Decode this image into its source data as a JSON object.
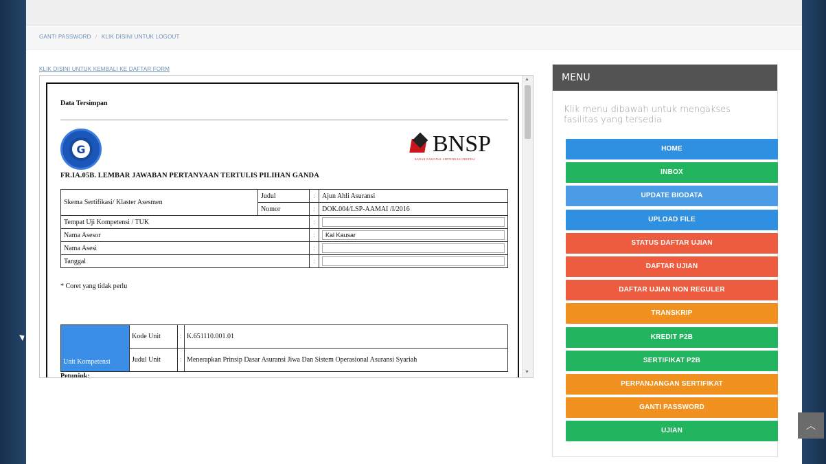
{
  "breadcrumb": {
    "change_password": "GANTI PASSWORD",
    "separator": "/",
    "logout": "KLIK DISINI UNTUK LOGOUT"
  },
  "back_link": "KLIK DISINI UNTUK KEMBALI KE DAFTAR FORM",
  "document": {
    "heading": "Data Tersimpan",
    "bnsp_logo_text": "BNSP",
    "bnsp_subtitle": "BADAN NASIONAL SERTIFIKASI PROFESI",
    "form_title": "FR.IA.05B. LEMBAR JAWABAN PERTANYAAN TERTULIS PILIHAN GANDA",
    "info": {
      "skema_label": "Skema Sertifikasi/ Klaster Asesmen",
      "judul_label": "Judul",
      "judul_value": "Ajun Ahli Asuransi",
      "nomor_label": "Nomor",
      "nomor_value": "DOK.004/LSP-AAMAI /I/2016",
      "tuk_label": "Tempat Uji Kompetensi / TUK",
      "tuk_value": "",
      "asesor_label": "Nama Asesor",
      "asesor_value": "Kal Kausar",
      "asesi_label": "Nama Asesi",
      "asesi_value": "",
      "tanggal_label": "Tanggal",
      "tanggal_value": "",
      "colon": ":"
    },
    "note": "* Coret yang tidak perlu",
    "unit": {
      "label": "Unit Kompetensi",
      "kode_label": "Kode Unit",
      "kode_value": "K.651110.001.01",
      "judul_label": "Judul Unit",
      "judul_value": "Menerapkan Prinsip Dasar Asuransi Jiwa Dan Sistem Operasional Asuransi Syariah",
      "colon": ":"
    },
    "cut_text": "Petunjuk:"
  },
  "menu": {
    "title": "MENU",
    "description": "Klik menu dibawah untuk mengakses fasilitas yang tersedia",
    "buttons": [
      {
        "label": "HOME",
        "color": "#2f8fe0"
      },
      {
        "label": "INBOX",
        "color": "#22b45f"
      },
      {
        "label": "UPDATE BIODATA",
        "color": "#4b9be6"
      },
      {
        "label": "UPLOAD FILE",
        "color": "#2f8fe0"
      },
      {
        "label": "STATUS DAFTAR UJIAN",
        "color": "#ee5c3f"
      },
      {
        "label": "DAFTAR UJIAN",
        "color": "#ee5c3f"
      },
      {
        "label": "DAFTAR UJIAN NON REGULER",
        "color": "#ee5c3f"
      },
      {
        "label": "TRANSKRIP",
        "color": "#f0901f"
      },
      {
        "label": "KREDIT P2B",
        "color": "#22b45f"
      },
      {
        "label": "SERTIFIKAT P2B",
        "color": "#22b45f"
      },
      {
        "label": "PERPANJANGAN SERTIFIKAT",
        "color": "#f0901f"
      },
      {
        "label": "GANTI PASSWORD",
        "color": "#f0901f"
      },
      {
        "label": "UJIAN",
        "color": "#22b45f"
      }
    ]
  },
  "icons": {
    "scroll_top": "chevron-up-icon",
    "cursor": "mouse-pointer-icon"
  }
}
